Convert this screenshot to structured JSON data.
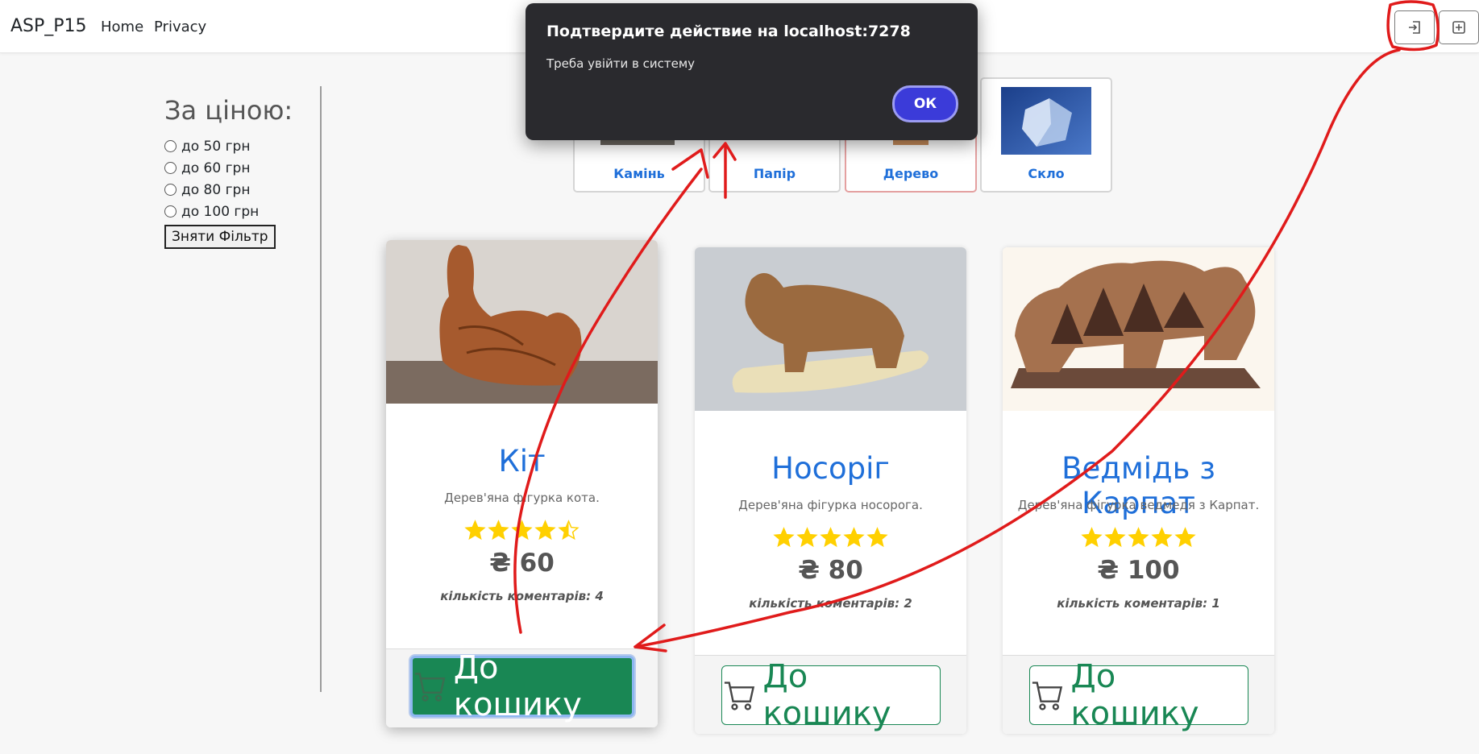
{
  "navbar": {
    "brand": "ASP_P15",
    "links": [
      "Home",
      "Privacy"
    ],
    "login_icon": "login-icon",
    "register_icon": "plus-square-icon"
  },
  "sidebar": {
    "title": "За ціною:",
    "options": [
      "до 50 грн",
      "до 60 грн",
      "до 80 грн",
      "до 100 грн"
    ],
    "clear_label": "Зняти Фільтр"
  },
  "categories": [
    {
      "label": "Камінь",
      "active": false
    },
    {
      "label": "Папір",
      "active": false
    },
    {
      "label": "Дерево",
      "active": true
    },
    {
      "label": "Скло",
      "active": false
    }
  ],
  "products": [
    {
      "title": "Кіт",
      "description": "Дерев'яна фігурка кота.",
      "rating": 4.5,
      "price": "₴ 60",
      "comments": "кількість коментарів: 4",
      "cart_label": "До кошику"
    },
    {
      "title": "Носоріг",
      "description": "Дерев'яна фігурка носорога.",
      "rating": 5,
      "price": "₴ 80",
      "comments": "кількість коментарів: 2",
      "cart_label": "До кошику"
    },
    {
      "title": "Ведмідь з Карпат",
      "description": "Дерев'яна фігурка ведмедя з Карпат.",
      "rating": 5,
      "price": "₴ 100",
      "comments": "кількість коментарів: 1",
      "cart_label": "До кошику"
    }
  ],
  "dialog": {
    "title": "Подтвердите действие на localhost:7278",
    "message": "Треба увійти в систему",
    "ok_label": "ОК"
  },
  "colors": {
    "link_blue": "#1f6fd9",
    "success_green": "#198754",
    "star_gold": "#ffd000",
    "dialog_bg": "#2a2a2e",
    "dialog_button": "#3b3bd9",
    "annotation_red": "#e01b1b"
  }
}
